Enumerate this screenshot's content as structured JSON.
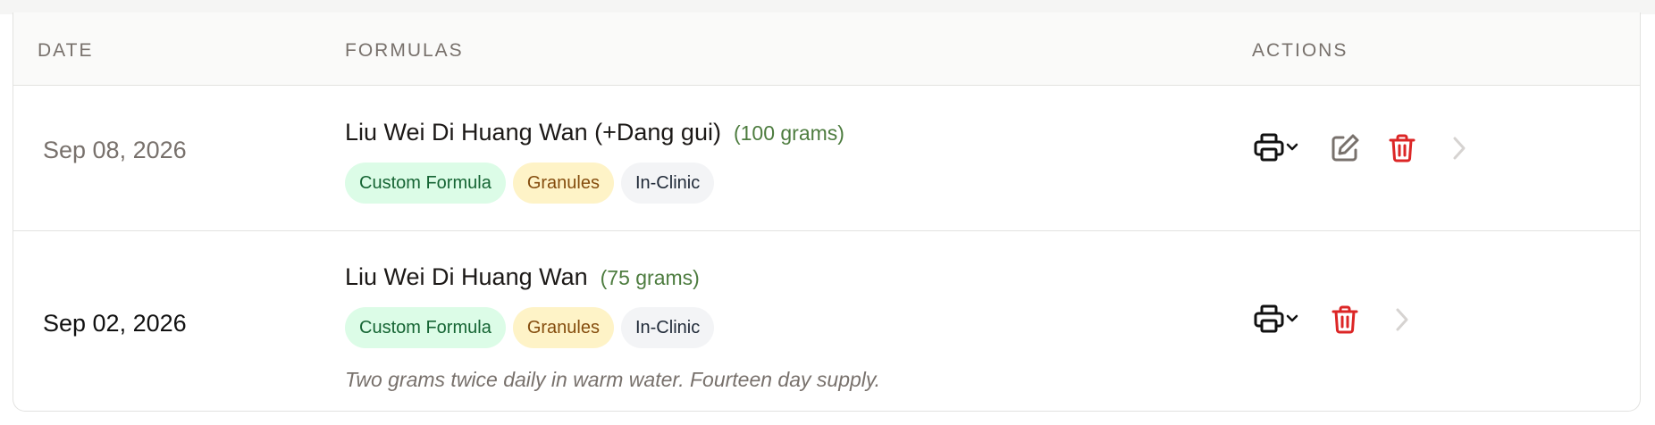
{
  "header": {
    "date": "DATE",
    "formulas": "FORMULAS",
    "actions": "ACTIONS"
  },
  "rows": [
    {
      "date": "Sep 08, 2026",
      "formula_name": "Liu Wei Di Huang Wan (+Dang gui)",
      "quantity": "(100 grams)",
      "tags": [
        "Custom Formula",
        "Granules",
        "In-Clinic"
      ],
      "note": "",
      "actions": [
        "printer-icon",
        "edit-icon",
        "trash-icon",
        "chevron-right-icon"
      ]
    },
    {
      "date": "Sep 02, 2026",
      "formula_name": "Liu Wei Di Huang Wan",
      "quantity": "(75 grams)",
      "tags": [
        "Custom Formula",
        "Granules",
        "In-Clinic"
      ],
      "note": "Two grams twice daily in warm water. Fourteen day supply.",
      "actions": [
        "printer-icon",
        "trash-icon",
        "chevron-right-icon"
      ]
    }
  ],
  "colors": {
    "tag_custom_bg": "#dcfce7",
    "tag_custom_text": "#166534",
    "tag_granules_bg": "#fef3c7",
    "tag_granules_text": "#854d0e",
    "tag_clinic_bg": "#f3f4f6",
    "quantity_text": "#4d7c3f",
    "delete_red": "#dc2626"
  }
}
